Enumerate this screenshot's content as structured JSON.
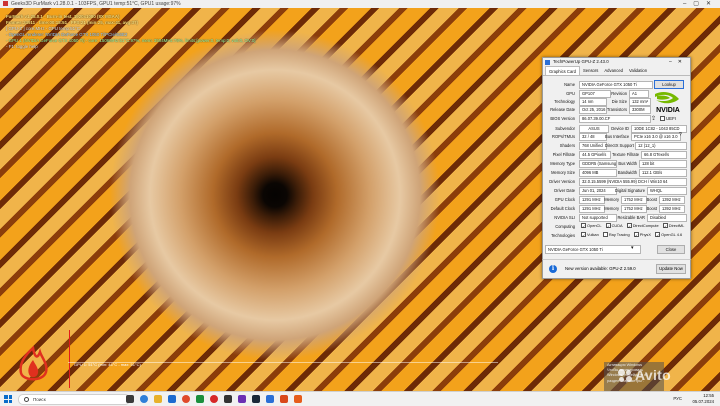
{
  "furmark": {
    "window_title": "Geeks3D FurMark v1.28.0.1 - 103FPS, GPU1 temp:51°C, GPU1 usage:97%",
    "overlay": [
      "FurMark v1.28.0.1 - Burn-in test, 1920x1080 (8X MSAA)",
      "Frames:24911 - time:00:18:51 - FPS:21 (min:25, max:41, avg:37)",
      "[ GPU-Z ] core:MHz - GPU temp:51°C",
      "- OpenGL renderer: NVIDIA GeForce GTX 1050 Ti/PCIe/SSE2",
      "- GPU 1 (NVIDIA GeForce GTX 1050 Ti) - core: 1506MHz:51°C:97%, mem: 3504MHz:78%, limits:[power:0, temp:0, volt:0, OV:0]",
      "- F1: toggle help"
    ],
    "graph_label": "GPU 1: 51°C (min: 46°C - max: 51°C)"
  },
  "gpuz": {
    "title": "TechPowerUp GPU-Z 2.43.0",
    "tabs": [
      "Graphics Card",
      "Sensors",
      "Advanced",
      "Validation"
    ],
    "active_tab": "Graphics Card",
    "name": "NVIDIA GeForce GTX 1050 Ti",
    "lookup_label": "Lookup",
    "gpu": "GP107",
    "revision": "A1",
    "technology": "14 nm",
    "die_size": "132 mm²",
    "release_date": "Oct 25, 2016",
    "transistors": "3300M",
    "bios_version": "86.07.39.00.CF",
    "uefi_label": "UEFI",
    "subvendor": "ASUS",
    "device_id": "10DE 1C82 - 1043 85CD",
    "rops_tmus": "32 / 48",
    "bus_interface": "PCIe x16 3.0 @ x16 3.0",
    "shaders": "768 Unified",
    "directx_support": "12 (12_1)",
    "pixel_fillrate": "44.5 GPixel/s",
    "texture_fillrate": "66.8 GTexel/s",
    "memory_type": "GDDR5 (Samsung)",
    "bus_width": "128 bit",
    "memory_size": "4096 MB",
    "bandwidth": "112.1 GB/s",
    "driver_version": "32.0.15.5599 (NVIDIA 555.99) DCH / Win10 64",
    "driver_date": "Jun 01, 2024",
    "digital_signature": "WHQL",
    "gpu_clock": "1291 MHz",
    "memory_clock": "1752 MHz",
    "boost_clock": "1392 MHz",
    "default_clock": "1291 MHz",
    "default_memory": "1752 MHz",
    "default_boost": "1392 MHz",
    "nvidia_sli": "Not supported",
    "resizable_bar": "Disabled",
    "computing": [
      "OpenCL",
      "CUDA",
      "DirectCompute",
      "DirectML"
    ],
    "technologies": [
      "Vulkan",
      "Ray Tracing",
      "PhysX",
      "OpenGL 4.6"
    ],
    "labels": {
      "name": "Name",
      "gpu": "GPU",
      "revision": "Revision",
      "technology": "Technology",
      "die_size": "Die Size",
      "release_date": "Release Date",
      "transistors": "Transistors",
      "bios_version": "BIOS Version",
      "subvendor": "Subvendor",
      "device_id": "Device ID",
      "rops_tmus": "ROPs/TMUs",
      "bus_interface": "Bus Interface",
      "shaders": "Shaders",
      "directx_support": "DirectX Support",
      "pixel_fillrate": "Pixel Fillrate",
      "texture_fillrate": "Texture Fillrate",
      "memory_type": "Memory Type",
      "bus_width": "Bus Width",
      "memory_size": "Memory Size",
      "bandwidth": "Bandwidth",
      "driver_version": "Driver Version",
      "driver_date": "Driver Date",
      "digital_signature": "Digital Signature",
      "gpu_clock": "GPU Clock",
      "memory": "Memory",
      "boost": "Boost",
      "default_clock": "Default Clock",
      "nvidia_sli": "NVIDIA SLI",
      "resizable_bar": "Resizable BAR",
      "computing": "Computing",
      "technologies": "Technologies"
    },
    "selected_gpu": "NVIDIA GeForce GTX 1050 Ti",
    "close_label": "Close",
    "update_message": "New version available: GPU-Z 2.59.0",
    "update_button": "Update Now"
  },
  "taskbar": {
    "search_placeholder": "Поиск",
    "time": "12:55",
    "date": "05.07.2024",
    "lang": "РУС"
  },
  "notification": {
    "lines": [
      "Активация Windows",
      "Чтобы активировать",
      "Windows, перейдите в",
      "раздел \"Параметры\"."
    ]
  },
  "watermark": "Avito"
}
